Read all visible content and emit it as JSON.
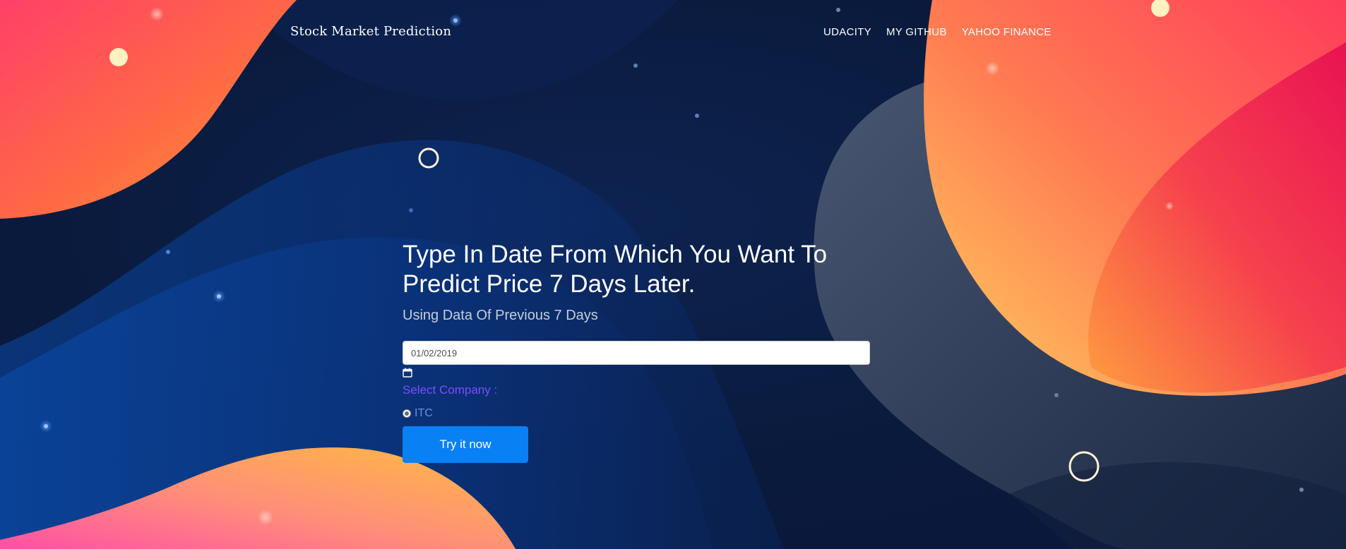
{
  "brand": {
    "title": "Stock Market Prediction"
  },
  "nav": {
    "links": [
      "UDACITY",
      "MY GITHUB",
      "YAHOO FINANCE"
    ]
  },
  "hero": {
    "title": "Type In Date From Which You Want To Predict Price 7 Days Later.",
    "subtitle": "Using Data Of Previous 7 Days"
  },
  "form": {
    "date_value": "01/02/2019",
    "calendar_icon": "calendar-icon",
    "company_label": "Select Company :",
    "company_options": [
      {
        "label": "ITC",
        "selected": true
      }
    ],
    "submit_label": "Try it now"
  },
  "colors": {
    "background": "#0a1a3c",
    "accent_button": "#0a80f5",
    "company_label": "#7c4dff",
    "radio_label": "#6d8fd6",
    "blob_orange": "#ff8a3d",
    "blob_pink": "#f0195a",
    "blob_grey": "#3a4660"
  }
}
